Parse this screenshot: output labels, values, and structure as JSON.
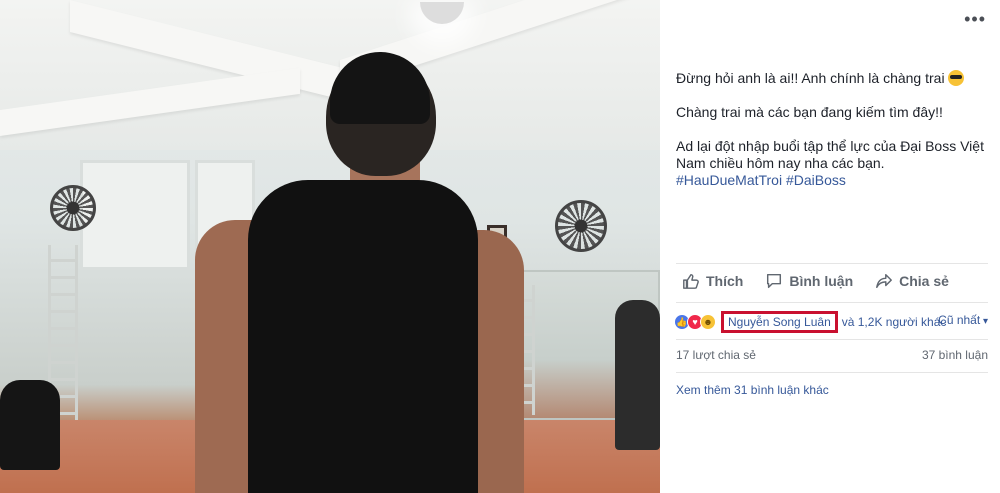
{
  "post": {
    "line1": "Đừng hỏi anh là ai!! Anh chính là chàng trai",
    "line2": "Chàng trai mà các bạn đang kiếm tìm đây!!",
    "line3": "Ad lại đột nhập buổi tập thể lực của Đại Boss Việt Nam chiều hôm nay nha các bạn.",
    "hashtags": "#HauDueMatTroi #DaiBoss"
  },
  "actions": {
    "like": "Thích",
    "comment": "Bình luận",
    "share": "Chia sẻ"
  },
  "reactions": {
    "highlighted_name": "Nguyễn Song Luân",
    "others": "và 1,2K người khác",
    "sort": "Cũ nhất"
  },
  "stats": {
    "shares": "17 lượt chia sẻ",
    "comments": "37 bình luận"
  },
  "more_comments": "Xem thêm 31 bình luận khác",
  "colors": {
    "link": "#365899",
    "highlight_box": "#c9102f",
    "like": "#4a76e8",
    "love": "#f0284a"
  }
}
